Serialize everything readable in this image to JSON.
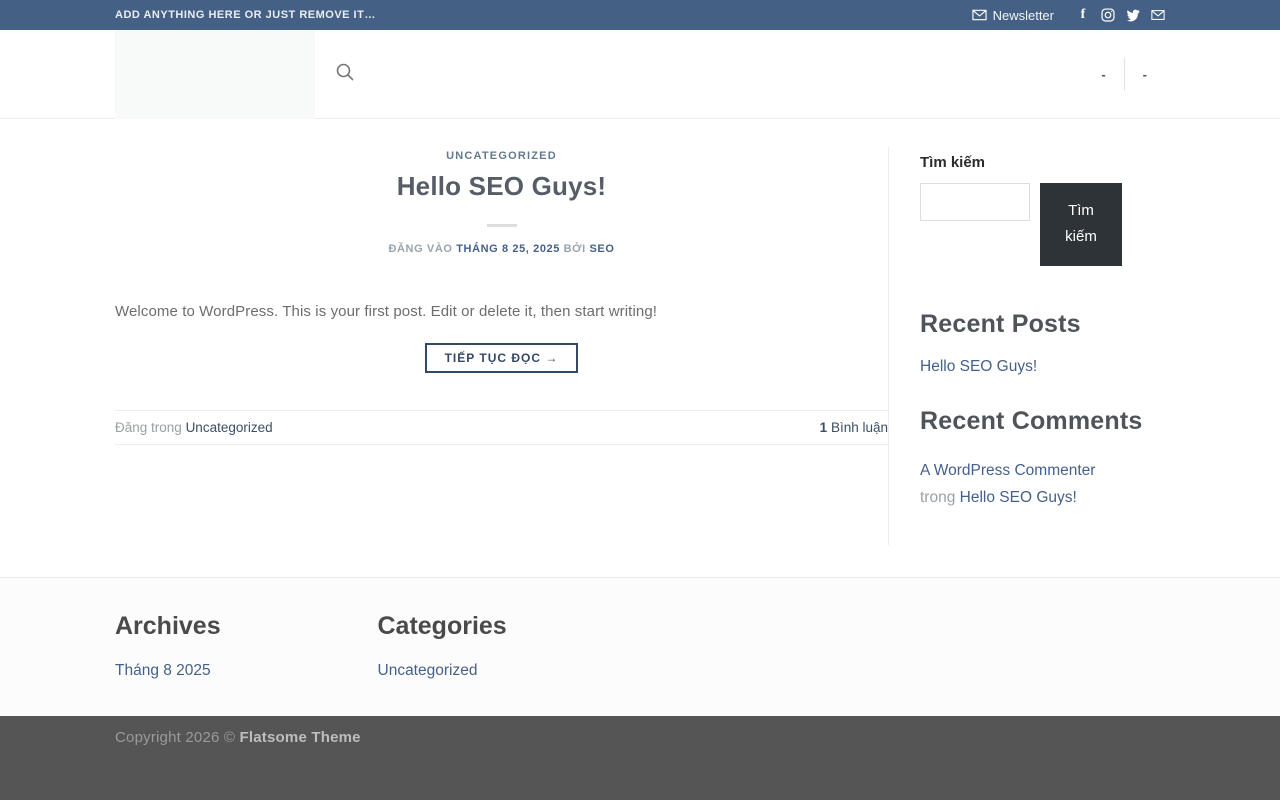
{
  "topbar": {
    "left_text": "ADD ANYTHING HERE OR JUST REMOVE IT…",
    "newsletter_label": "Newsletter",
    "social_icons": [
      "facebook-icon",
      "instagram-icon",
      "twitter-icon",
      "email-icon"
    ]
  },
  "header": {
    "menu_items": {
      "0": "-",
      "1": "-"
    }
  },
  "post": {
    "category": "UNCATEGORIZED",
    "title": "Hello SEO Guys!",
    "posted_on_label": "ĐĂNG VÀO",
    "date": "THÁNG 8 25, 2025",
    "by_label": "BỞI",
    "author": "SEO",
    "excerpt": "Welcome to WordPress. This is your first post. Edit or delete it, then start writing!",
    "read_more_label": "TIẾP TỤC ĐỌC →",
    "posted_in_label": "Đăng trong",
    "posted_in_category": "Uncategorized",
    "comments_count": "1",
    "comments_label": "Bình luận"
  },
  "sidebar": {
    "search": {
      "label": "Tìm kiếm",
      "input_value": "",
      "button_label": "Tìm kiếm"
    },
    "recent_posts": {
      "title": "Recent Posts",
      "items": {
        "0": "Hello SEO Guys!"
      }
    },
    "recent_comments": {
      "title": "Recent Comments",
      "items": {
        "0": {
          "author": "A WordPress Commenter",
          "in_label": "trong",
          "post": "Hello SEO Guys!"
        }
      }
    }
  },
  "footer": {
    "archives": {
      "title": "Archives",
      "items": {
        "0": "Tháng 8 2025"
      }
    },
    "categories": {
      "title": "Categories",
      "items": {
        "0": "Uncategorized"
      }
    },
    "copyright_prefix": "Copyright 2026 © ",
    "copyright_brand": "Flatsome Theme"
  },
  "colors": {
    "accent": "#446084",
    "topbar_bg": "#446084",
    "outline_button": "#344868",
    "search_button_bg": "#2e3338",
    "footer_dark_bg": "#555555",
    "heading": "#555d66",
    "link_dark": "#3c4f66",
    "muted_text": "#9aa0a6",
    "divider": "#ececec"
  }
}
